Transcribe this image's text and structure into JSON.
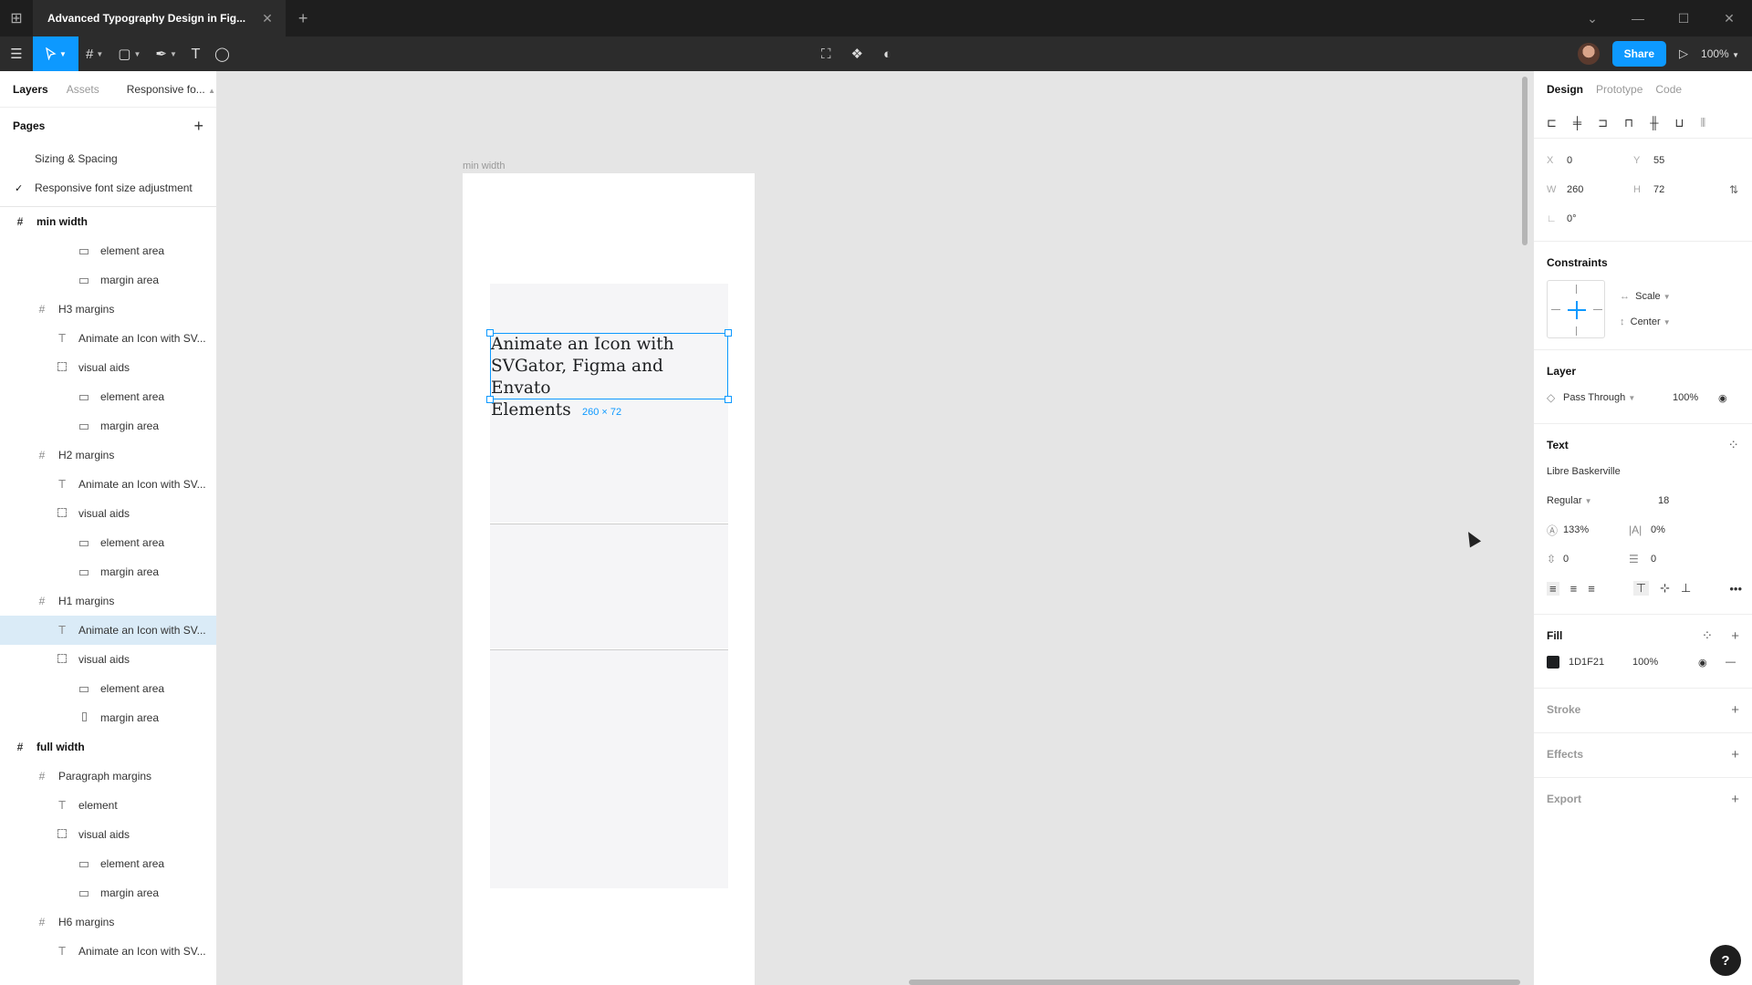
{
  "titlebar": {
    "tab_title": "Advanced Typography Design in Fig...",
    "tab_close": "✕",
    "new_tab": "+",
    "win_dropdown": "⌄",
    "win_minimize": "—",
    "win_maximize": "☐",
    "win_close": "✕"
  },
  "toolbar": {
    "share_label": "Share",
    "zoom": "100%"
  },
  "left_panel": {
    "tabs": {
      "layers": "Layers",
      "assets": "Assets",
      "page_select": "Responsive fo..."
    },
    "pages_title": "Pages",
    "pages": [
      {
        "label": "Sizing & Spacing",
        "checked": ""
      },
      {
        "label": "Responsive font size adjustment",
        "checked": "✓"
      }
    ],
    "layers": [
      {
        "label": "min width",
        "type": "frame",
        "indent": 0
      },
      {
        "label": "element area",
        "type": "rect",
        "indent": 2
      },
      {
        "label": "margin area",
        "type": "rect",
        "indent": 2
      },
      {
        "label": "H3 margins",
        "type": "frame",
        "indent": 1
      },
      {
        "label": "Animate an Icon with SV...",
        "type": "text",
        "indent": 1.6
      },
      {
        "label": "visual aids",
        "type": "group",
        "indent": 1.6
      },
      {
        "label": "element area",
        "type": "rect",
        "indent": 2
      },
      {
        "label": "margin area",
        "type": "rect",
        "indent": 2
      },
      {
        "label": "H2 margins",
        "type": "frame",
        "indent": 1
      },
      {
        "label": "Animate an Icon with SV...",
        "type": "text",
        "indent": 1.6
      },
      {
        "label": "visual aids",
        "type": "group",
        "indent": 1.6
      },
      {
        "label": "element area",
        "type": "rect",
        "indent": 2
      },
      {
        "label": "margin area",
        "type": "rect",
        "indent": 2
      },
      {
        "label": "H1 margins",
        "type": "frame",
        "indent": 1
      },
      {
        "label": "Animate an Icon with SV...",
        "type": "text",
        "indent": 1.6,
        "selected": true
      },
      {
        "label": "visual aids",
        "type": "group",
        "indent": 1.6
      },
      {
        "label": "element area",
        "type": "rect",
        "indent": 2
      },
      {
        "label": "margin area",
        "type": "vrect",
        "indent": 2
      },
      {
        "label": "full width",
        "type": "frame",
        "indent": 0
      },
      {
        "label": "Paragraph margins",
        "type": "frame",
        "indent": 1
      },
      {
        "label": "element",
        "type": "text",
        "indent": 1.6
      },
      {
        "label": "visual aids",
        "type": "group",
        "indent": 1.6
      },
      {
        "label": "element area",
        "type": "rect",
        "indent": 2
      },
      {
        "label": "margin area",
        "type": "rect",
        "indent": 2
      },
      {
        "label": "H6 margins",
        "type": "frame",
        "indent": 1
      },
      {
        "label": "Animate an Icon with SV...",
        "type": "text",
        "indent": 1.6
      }
    ]
  },
  "canvas": {
    "frame_label": "min width",
    "selected_text": "Animate an Icon with\nSVGator, Figma and Envato\nElements",
    "dimension_label": "260 × 72"
  },
  "right_panel": {
    "tabs": {
      "design": "Design",
      "prototype": "Prototype",
      "code": "Code"
    },
    "position": {
      "x_key": "X",
      "x": "0",
      "y_key": "Y",
      "y": "55",
      "w_key": "W",
      "w": "260",
      "h_key": "H",
      "h": "72",
      "rotation": "0°"
    },
    "constraints": {
      "title": "Constraints",
      "horizontal": "Scale",
      "vertical": "Center"
    },
    "layer": {
      "title": "Layer",
      "blend": "Pass Through",
      "opacity": "100%"
    },
    "text": {
      "title": "Text",
      "font": "Libre Baskerville",
      "weight": "Regular",
      "size": "18",
      "line_height": "133%",
      "letter_spacing": "0%",
      "paragraph_spacing": "0",
      "paragraph_indent": "0"
    },
    "fill": {
      "title": "Fill",
      "hex": "1D1F21",
      "opacity": "100%"
    },
    "stroke": {
      "title": "Stroke"
    },
    "effects": {
      "title": "Effects"
    },
    "export": {
      "title": "Export"
    }
  },
  "help": "?"
}
